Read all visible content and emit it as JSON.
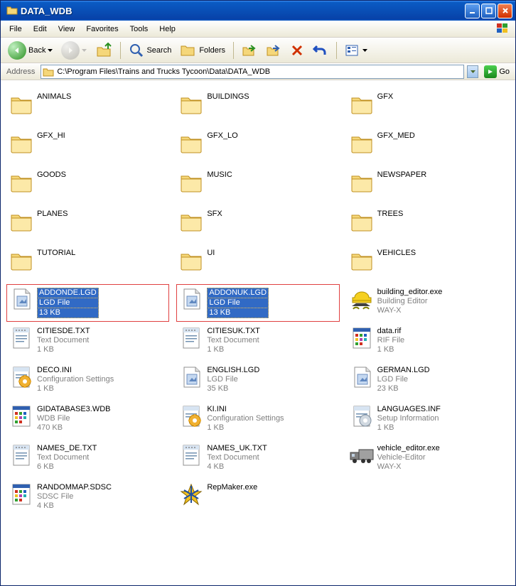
{
  "window": {
    "title": "DATA_WDB"
  },
  "menu": {
    "file": "File",
    "edit": "Edit",
    "view": "View",
    "favorites": "Favorites",
    "tools": "Tools",
    "help": "Help"
  },
  "toolbar": {
    "back": "Back",
    "search": "Search",
    "folders": "Folders"
  },
  "address": {
    "label": "Address",
    "path": "C:\\Program Files\\Trains and Trucks Tycoon\\Data\\DATA_WDB",
    "go": "Go"
  },
  "items": [
    {
      "name": "ANIMALS",
      "type": "folder"
    },
    {
      "name": "BUILDINGS",
      "type": "folder"
    },
    {
      "name": "GFX",
      "type": "folder"
    },
    {
      "name": "GFX_HI",
      "type": "folder"
    },
    {
      "name": "GFX_LO",
      "type": "folder"
    },
    {
      "name": "GFX_MED",
      "type": "folder"
    },
    {
      "name": "GOODS",
      "type": "folder"
    },
    {
      "name": "MUSIC",
      "type": "folder"
    },
    {
      "name": "NEWSPAPER",
      "type": "folder"
    },
    {
      "name": "PLANES",
      "type": "folder"
    },
    {
      "name": "SFX",
      "type": "folder"
    },
    {
      "name": "TREES",
      "type": "folder"
    },
    {
      "name": "TUTORIAL",
      "type": "folder"
    },
    {
      "name": "UI",
      "type": "folder"
    },
    {
      "name": "VEHICLES",
      "type": "folder"
    },
    {
      "name": "ADDONDE.LGD",
      "sub1": "LGD File",
      "sub2": "13 KB",
      "type": "lgd",
      "selected": true
    },
    {
      "name": "ADDONUK.LGD",
      "sub1": "LGD File",
      "sub2": "13 KB",
      "type": "lgd",
      "selected": true
    },
    {
      "name": "building_editor.exe",
      "sub1": "Building Editor",
      "sub2": "WAY-X",
      "type": "buildexe"
    },
    {
      "name": "CITIESDE.TXT",
      "sub1": "Text Document",
      "sub2": "1 KB",
      "type": "txt"
    },
    {
      "name": "CITIESUK.TXT",
      "sub1": "Text Document",
      "sub2": "1 KB",
      "type": "txt"
    },
    {
      "name": "data.rif",
      "sub1": "RIF File",
      "sub2": "1 KB",
      "type": "rif"
    },
    {
      "name": "DECO.INI",
      "sub1": "Configuration Settings",
      "sub2": "1 KB",
      "type": "ini"
    },
    {
      "name": "ENGLISH.LGD",
      "sub1": "LGD File",
      "sub2": "35 KB",
      "type": "lgd"
    },
    {
      "name": "GERMAN.LGD",
      "sub1": "LGD File",
      "sub2": "23 KB",
      "type": "lgd"
    },
    {
      "name": "GIDATABASE3.WDB",
      "sub1": "WDB File",
      "sub2": "470 KB",
      "type": "rif"
    },
    {
      "name": "KI.INI",
      "sub1": "Configuration Settings",
      "sub2": "1 KB",
      "type": "ini"
    },
    {
      "name": "LANGUAGES.INF",
      "sub1": "Setup Information",
      "sub2": "1 KB",
      "type": "inf"
    },
    {
      "name": "NAMES_DE.TXT",
      "sub1": "Text Document",
      "sub2": "6 KB",
      "type": "txt"
    },
    {
      "name": "NAMES_UK.TXT",
      "sub1": "Text Document",
      "sub2": "4 KB",
      "type": "txt"
    },
    {
      "name": "vehicle_editor.exe",
      "sub1": "Vehicle-Editor",
      "sub2": "WAY-X",
      "type": "vehicleexe"
    },
    {
      "name": "RANDOMMAP.SDSC",
      "sub1": "SDSC File",
      "sub2": "4 KB",
      "type": "rif"
    },
    {
      "name": "RepMaker.exe",
      "sub1": "",
      "sub2": "",
      "type": "repexe"
    }
  ]
}
